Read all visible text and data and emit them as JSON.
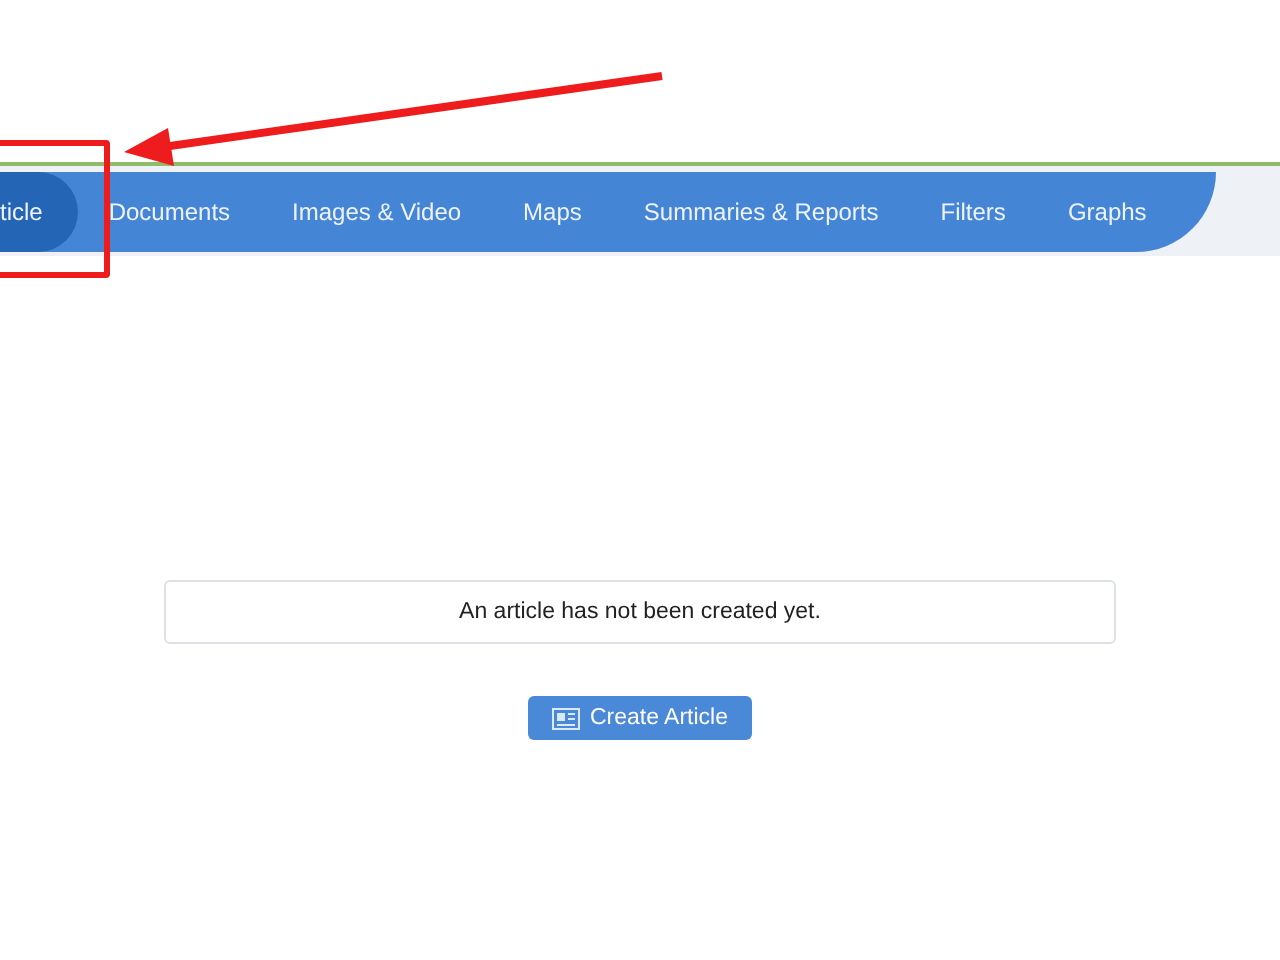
{
  "nav": {
    "tabs": [
      {
        "label": "ticle",
        "selected": true
      },
      {
        "label": "Documents",
        "selected": false
      },
      {
        "label": "Images & Video",
        "selected": false
      },
      {
        "label": "Maps",
        "selected": false
      },
      {
        "label": "Summaries & Reports",
        "selected": false
      },
      {
        "label": "Filters",
        "selected": false
      },
      {
        "label": "Graphs",
        "selected": false
      }
    ]
  },
  "message": "An article has not been created yet.",
  "button": {
    "label": "Create Article"
  }
}
